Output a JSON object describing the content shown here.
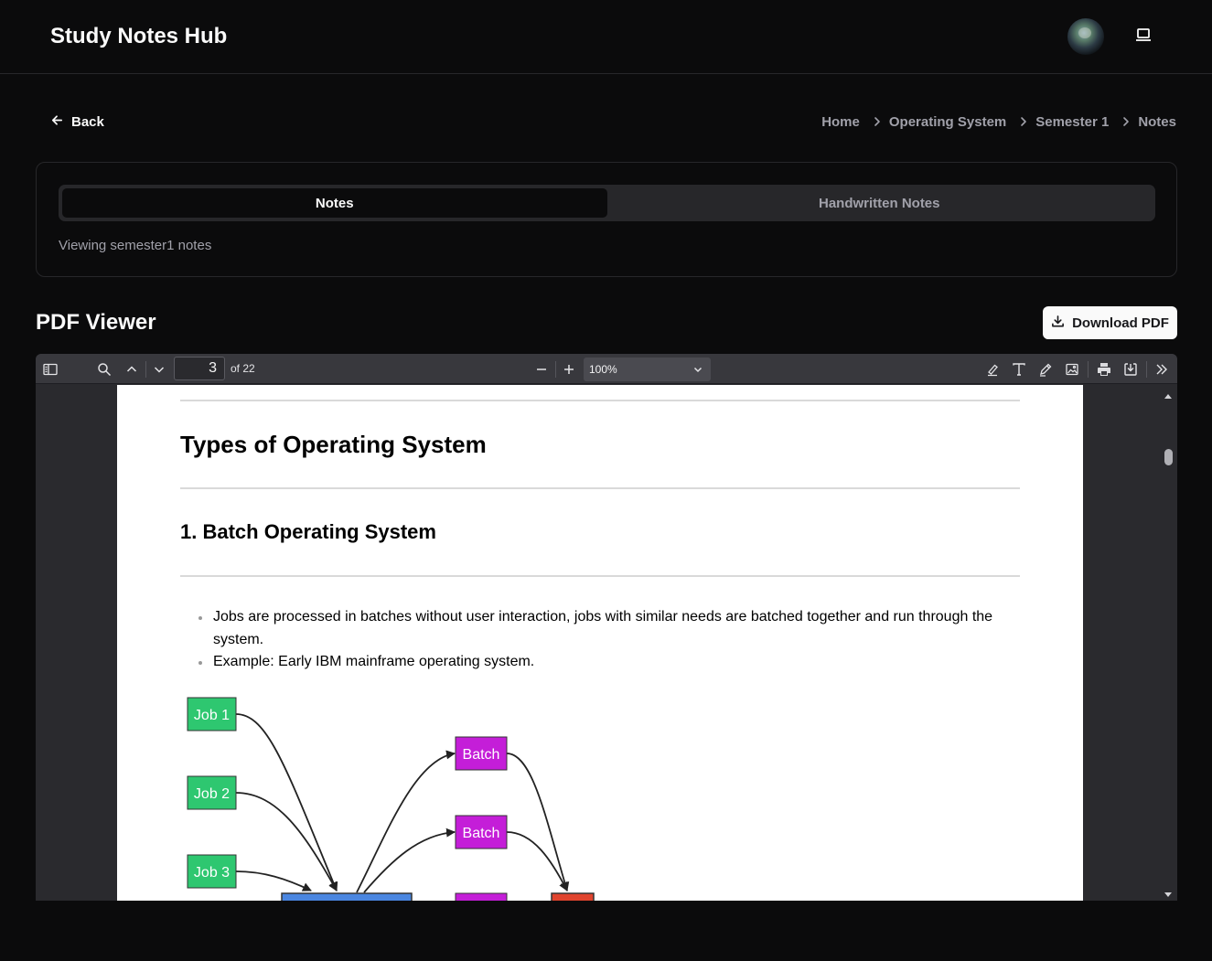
{
  "app": {
    "title": "Study Notes Hub"
  },
  "nav": {
    "back_label": "Back",
    "breadcrumbs": [
      "Home",
      "Operating System",
      "Semester 1",
      "Notes"
    ]
  },
  "tabs": [
    {
      "label": "Notes",
      "active": true
    },
    {
      "label": "Handwritten Notes",
      "active": false
    }
  ],
  "viewing_text": "Viewing semester1 notes",
  "pdf": {
    "section_title": "PDF Viewer",
    "download_label": "Download PDF",
    "toolbar": {
      "current_page": "3",
      "page_count_label": "of 22",
      "zoom": "100%"
    },
    "content": {
      "heading": "Types of Operating System",
      "subheading": "1. Batch Operating System",
      "bullets": [
        "Jobs are processed in batches without user interaction, jobs with similar needs are batched together and run through the system.",
        "Example: Early IBM mainframe operating system."
      ],
      "diagram": {
        "jobs": [
          "Job 1",
          "Job 2",
          "Job 3"
        ],
        "batches": [
          "Batch",
          "Batch"
        ],
        "colors": {
          "job": "#2ec770",
          "batch": "#c41ed8",
          "processor": "#4a86e0",
          "output": "#e0442e"
        }
      }
    }
  },
  "icons": {
    "back": "arrow-left-icon",
    "crumb_sep": "chevron-right-icon",
    "theme": "laptop-icon",
    "download": "download-icon"
  }
}
